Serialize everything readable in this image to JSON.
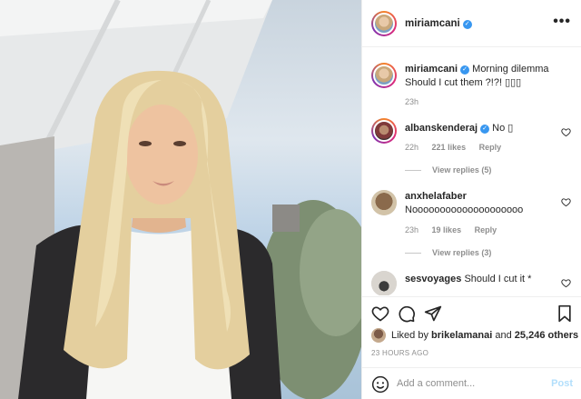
{
  "header": {
    "username": "miriamcani",
    "more_label": "•••"
  },
  "caption": {
    "username": "miriamcani",
    "text_line1": "Morning dilemma",
    "text_line2": "Should I cut them ?!?! ▯▯▯",
    "time": "23h"
  },
  "comments": [
    {
      "username": "albanskenderaj",
      "text": "No ▯",
      "time": "22h",
      "likes": "221 likes",
      "reply": "Reply",
      "view_replies": "View replies (5)"
    },
    {
      "username": "anxhelafaber",
      "text": "Noooooooooooooooooooo",
      "time": "23h",
      "likes": "19 likes",
      "reply": "Reply",
      "view_replies": "View replies (3)"
    },
    {
      "username": "sesvoyages",
      "text": "Should I cut it *"
    }
  ],
  "likes": {
    "prefix": "Liked by",
    "user": "brikelamanai",
    "connector": "and",
    "count": "25,246 others"
  },
  "timestamp": "23 HOURS AGO",
  "add_comment": {
    "placeholder": "Add a comment...",
    "post_label": "Post"
  },
  "colors": {
    "verified": "#3897f0",
    "post_disabled": "#b2dffc",
    "meta": "#8e8e8e"
  },
  "icons": [
    "heart-icon",
    "comment-icon",
    "share-icon",
    "bookmark-icon",
    "emoji-icon",
    "verified-icon",
    "more-icon"
  ]
}
